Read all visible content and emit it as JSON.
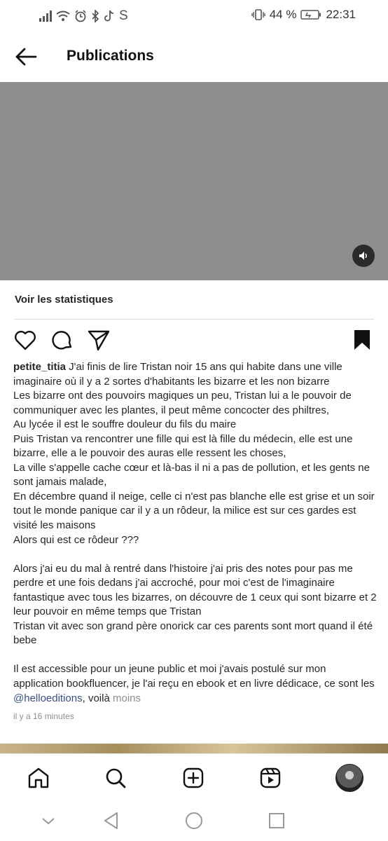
{
  "status_bar": {
    "carrier_icon": "S",
    "battery": "44 %",
    "time": "22:31",
    "icons": [
      "signal-icon",
      "wifi-icon",
      "alarm-icon",
      "bluetooth-icon",
      "tiktok-icon",
      "vibrate-icon",
      "battery-icon"
    ]
  },
  "header": {
    "title": "Publications",
    "back_icon": "arrow-left-icon"
  },
  "media": {
    "sound_icon": "volume-icon",
    "placeholder_color": "#8e8e8e"
  },
  "post": {
    "stats_label": "Voir les statistiques",
    "actions": [
      "like-icon",
      "comment-icon",
      "share-icon",
      "save-icon"
    ],
    "username": "petite_titia",
    "caption_before_mention": " J'ai finis de lire Tristan noir 15 ans qui habite dans une ville imaginaire où il y a 2 sortes d'habitants les bizarre et les non bizarre\nLes bizarre ont des pouvoirs magiques un peu, Tristan lui a le pouvoir de communiquer avec les plantes, il peut même concocter des philtres,\nAu lycée il est le souffre douleur du fils du maire\nPuis Tristan va rencontrer une fille qui est là fille du médecin, elle est une bizarre, elle a le pouvoir des auras elle ressent les choses,\nLa ville s'appelle cache cœur et là-bas il ni a pas de pollution, et les gents ne sont jamais malade,\nEn décembre quand il neige, celle ci n'est pas blanche elle est grise et un soir tout le monde panique car il y a un rôdeur, la milice est sur ces gardes est visité les maisons\nAlors qui est ce rôdeur ???\n\nAlors j'ai eu du mal à rentré dans l'histoire j'ai pris des notes pour pas me perdre et une fois dedans j'ai accroché, pour moi c'est de l'imaginaire fantastique avec tous les bizarres, on découvre de 1 ceux qui sont bizarre et 2 leur pouvoir en même temps que Tristan\nTristan vit avec son grand père onorick car ces parents sont mort quand il été bebe\n\nIl est accessible pour un jeune public et moi j'avais postulé sur mon application bookfluencer, je l'ai reçu en ebook et en livre dédicace, ce sont les ",
    "mention": "@helloeditions",
    "caption_after_mention": ", voilà ",
    "less_label": "moins",
    "timestamp": "il y a 16 minutes",
    "mention_color": "#385185"
  },
  "bottom_nav": {
    "items": [
      "home-icon",
      "search-icon",
      "create-icon",
      "reels-icon",
      "profile-avatar"
    ]
  },
  "system_nav": {
    "items": [
      "collapse-icon",
      "back-triangle-icon",
      "home-circle-icon",
      "recents-square-icon"
    ]
  }
}
